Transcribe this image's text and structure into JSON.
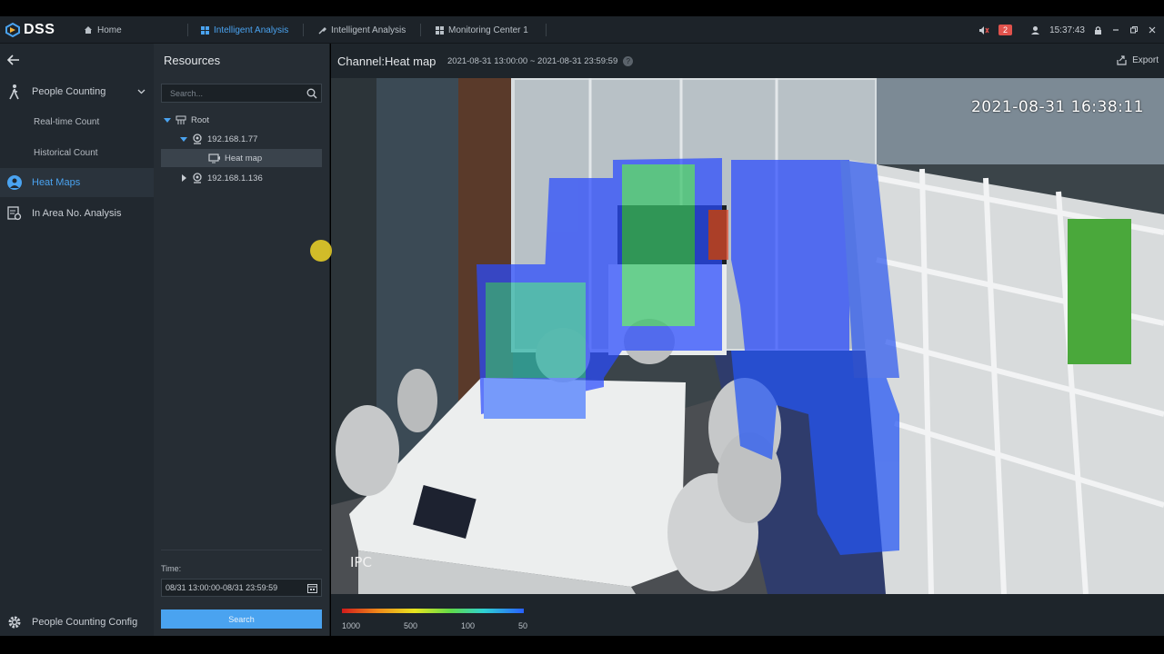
{
  "app": {
    "logo": "DSS"
  },
  "tabs": [
    {
      "label": "Home",
      "icon": "home-icon",
      "active": false
    },
    {
      "label": "Intelligent Analysis",
      "icon": "grid-icon",
      "active": true
    },
    {
      "label": "Intelligent Analysis",
      "icon": "tool-icon",
      "active": false
    },
    {
      "label": "Monitoring Center 1",
      "icon": "grid-icon",
      "active": false
    }
  ],
  "topright": {
    "alarm_count": "2",
    "clock": "15:37:43"
  },
  "sidebar": {
    "items": [
      {
        "label": "People Counting",
        "icon": "person-walk-icon"
      },
      {
        "label": "Real-time Count"
      },
      {
        "label": "Historical Count"
      },
      {
        "label": "Heat Maps",
        "icon": "heatmap-icon",
        "active": true
      },
      {
        "label": "In Area No. Analysis",
        "icon": "area-analysis-icon"
      }
    ],
    "config_label": "People Counting Config"
  },
  "resources": {
    "title": "Resources",
    "search_placeholder": "Search...",
    "tree": [
      {
        "label": "Root"
      },
      {
        "label": "192.168.1.77"
      },
      {
        "label": "Heat map",
        "selected": true
      },
      {
        "label": "192.168.1.136"
      }
    ],
    "time_label": "Time:",
    "time_value": "08/31 13:00:00-08/31 23:59:59",
    "search_button": "Search"
  },
  "main": {
    "channel_title": "Channel:Heat map",
    "time_range": "2021-08-31 13:00:00 ~ 2021-08-31 23:59:59",
    "export_label": "Export",
    "osd_timestamp": "2021-08-31 16:38:11",
    "osd_camera": "IPC",
    "legend_labels": [
      "1000",
      "500",
      "100",
      "50"
    ],
    "legend_colors": [
      "#d11b1b",
      "#e7e51f",
      "#5fdb4a",
      "#2860ff"
    ]
  }
}
